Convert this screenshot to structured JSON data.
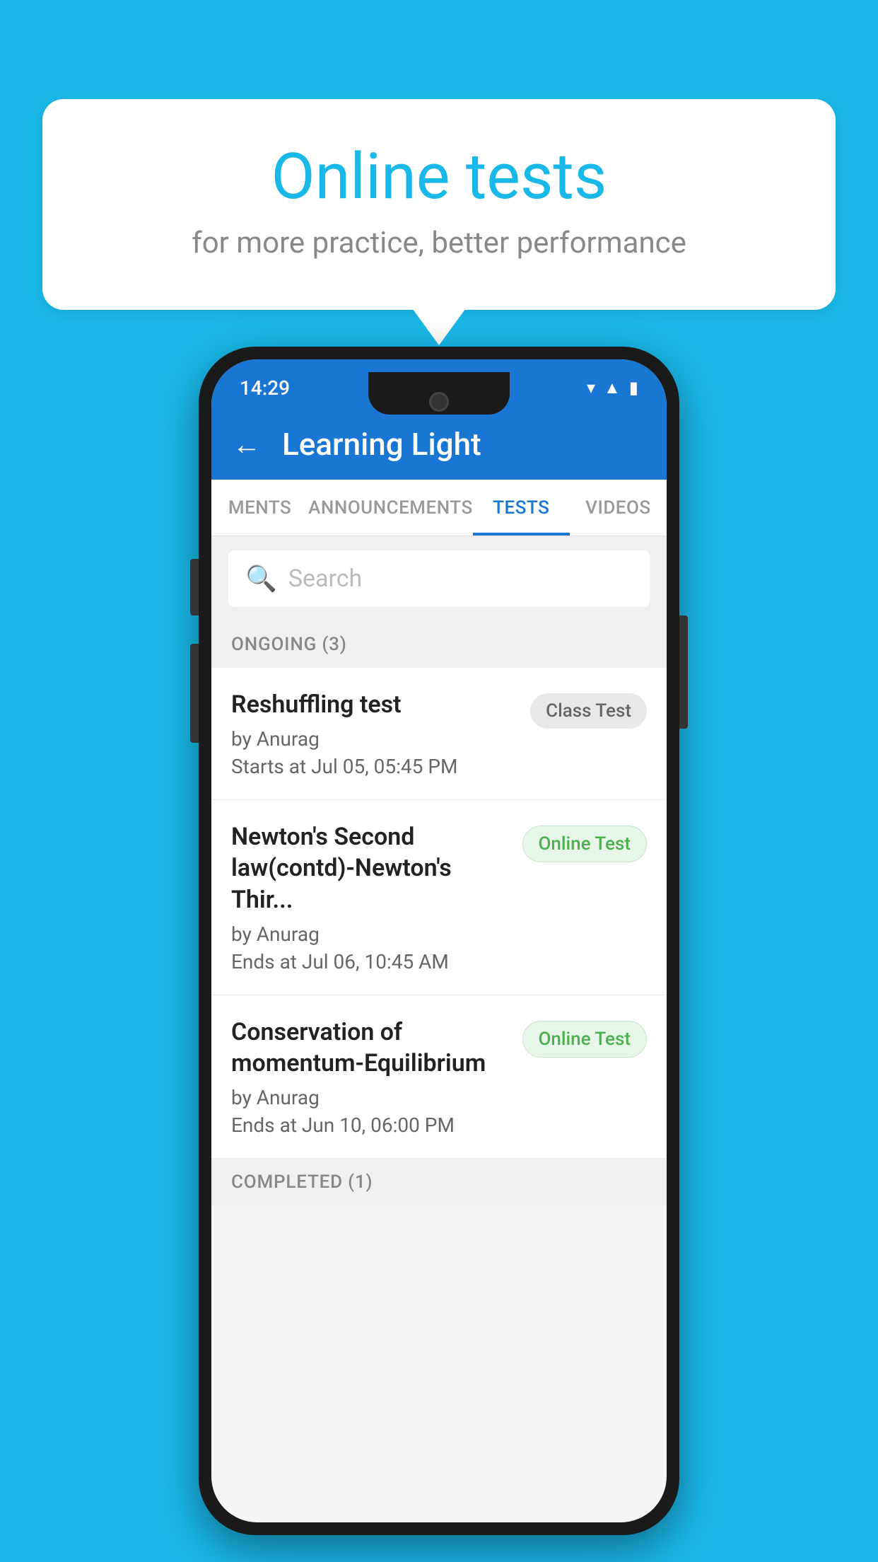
{
  "background": {
    "color": "#1ab8e8"
  },
  "bubble": {
    "title": "Online tests",
    "subtitle": "for more practice, better performance"
  },
  "phone": {
    "status_bar": {
      "time": "14:29",
      "icons": [
        "wifi",
        "signal",
        "battery"
      ]
    },
    "app_bar": {
      "title": "Learning Light",
      "back_label": "←"
    },
    "tabs": [
      {
        "label": "MENTS",
        "active": false
      },
      {
        "label": "ANNOUNCEMENTS",
        "active": false
      },
      {
        "label": "TESTS",
        "active": true
      },
      {
        "label": "VIDEOS",
        "active": false
      }
    ],
    "search": {
      "placeholder": "Search"
    },
    "ongoing_section": {
      "label": "ONGOING (3)"
    },
    "tests": [
      {
        "name": "Reshuffling test",
        "author": "by Anurag",
        "date": "Starts at  Jul 05, 05:45 PM",
        "badge": "Class Test",
        "badge_type": "class"
      },
      {
        "name": "Newton's Second law(contd)-Newton's Thir...",
        "author": "by Anurag",
        "date": "Ends at  Jul 06, 10:45 AM",
        "badge": "Online Test",
        "badge_type": "online"
      },
      {
        "name": "Conservation of momentum-Equilibrium",
        "author": "by Anurag",
        "date": "Ends at  Jun 10, 06:00 PM",
        "badge": "Online Test",
        "badge_type": "online"
      }
    ],
    "completed_section": {
      "label": "COMPLETED (1)"
    }
  }
}
